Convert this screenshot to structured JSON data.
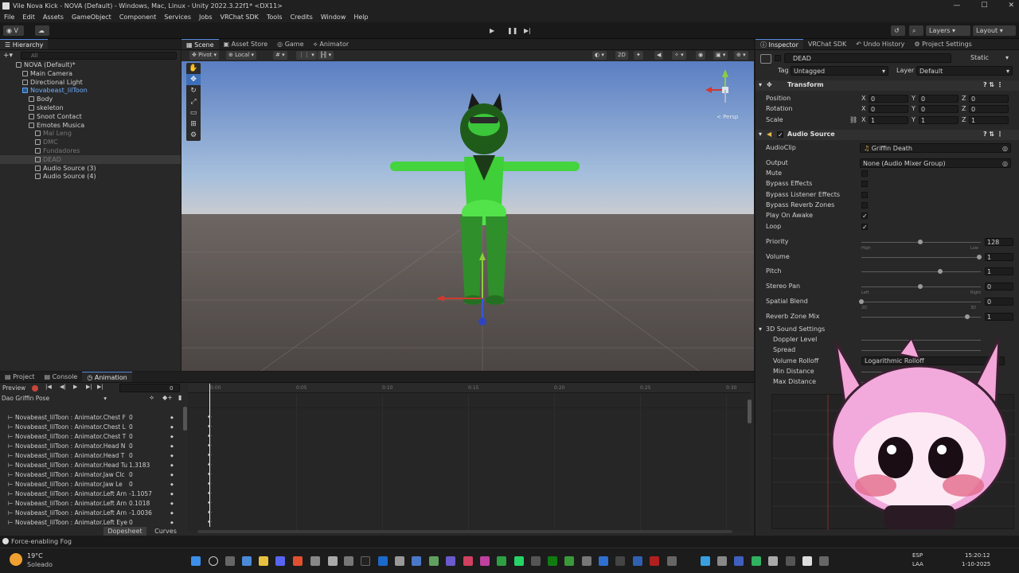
{
  "window": {
    "title": "Vile Nova Kick - NOVA (Default) - Windows, Mac, Linux - Unity 2022.3.22f1* <DX11>"
  },
  "menu": [
    "File",
    "Edit",
    "Assets",
    "GameObject",
    "Component",
    "Services",
    "Jobs",
    "VRChat SDK",
    "Tools",
    "Credits",
    "Window",
    "Help"
  ],
  "toolbar": {
    "account": "V",
    "layers_label": "Layers",
    "layout_label": "Layout"
  },
  "hierarchy": {
    "tab": "Hierarchy",
    "search_placeholder": "All",
    "items": [
      {
        "label": "NOVA (Default)*",
        "indent": 0,
        "dim": false
      },
      {
        "label": "Main Camera",
        "indent": 1,
        "dim": false
      },
      {
        "label": "Directional Light",
        "indent": 1,
        "dim": false
      },
      {
        "label": "Novabeast_lilToon",
        "indent": 1,
        "dim": false
      },
      {
        "label": "Body",
        "indent": 2,
        "dim": false
      },
      {
        "label": "skeleton",
        "indent": 2,
        "dim": false
      },
      {
        "label": "Snoot Contact",
        "indent": 2,
        "dim": false
      },
      {
        "label": "Emotes Musica",
        "indent": 2,
        "dim": false
      },
      {
        "label": "Mal Leng",
        "indent": 3,
        "dim": true
      },
      {
        "label": "DMC",
        "indent": 3,
        "dim": true
      },
      {
        "label": "Fundadores",
        "indent": 3,
        "dim": true
      },
      {
        "label": "DEAD",
        "indent": 3,
        "dim": true
      },
      {
        "label": "Audio Source (3)",
        "indent": 3,
        "dim": false
      },
      {
        "label": "Audio Source (4)",
        "indent": 3,
        "dim": false
      }
    ]
  },
  "scene": {
    "tabs": [
      "Scene",
      "Asset Store",
      "Game",
      "Animator"
    ],
    "pivot": "Pivot",
    "local": "Local",
    "mode_2d": "2D",
    "persp_label": "< Persp"
  },
  "inspector": {
    "tabs": [
      "Inspector",
      "VRChat SDK",
      "Undo History",
      "Project Settings"
    ],
    "object_name": "DEAD",
    "static_label": "Static",
    "tag_label": "Tag",
    "tag_value": "Untagged",
    "layer_label": "Layer",
    "layer_value": "Default",
    "transform": {
      "title": "Transform",
      "rows": [
        {
          "label": "Position",
          "x": "0",
          "y": "0",
          "z": "0"
        },
        {
          "label": "Rotation",
          "x": "0",
          "y": "0",
          "z": "0"
        },
        {
          "label": "Scale",
          "x": "1",
          "y": "1",
          "z": "1"
        }
      ]
    },
    "audio": {
      "title": "Audio Source",
      "clip_label": "AudioClip",
      "clip_value": "Griffin Death",
      "output_label": "Output",
      "output_value": "None (Audio Mixer Group)",
      "toggles": [
        {
          "label": "Mute",
          "checked": false
        },
        {
          "label": "Bypass Effects",
          "checked": false
        },
        {
          "label": "Bypass Listener Effects",
          "checked": false
        },
        {
          "label": "Bypass Reverb Zones",
          "checked": false
        },
        {
          "label": "Play On Awake",
          "checked": true
        },
        {
          "label": "Loop",
          "checked": true
        }
      ],
      "sliders": [
        {
          "label": "Priority",
          "value": "128",
          "pos": 0.5,
          "left": "High",
          "right": "Low"
        },
        {
          "label": "Volume",
          "value": "1",
          "pos": 1.0,
          "left": "",
          "right": ""
        },
        {
          "label": "Pitch",
          "value": "1",
          "pos": 0.67,
          "left": "",
          "right": ""
        },
        {
          "label": "Stereo Pan",
          "value": "0",
          "pos": 0.5,
          "left": "Left",
          "right": "Right"
        },
        {
          "label": "Spatial Blend",
          "value": "0",
          "pos": 0.0,
          "left": "2D",
          "right": "3D"
        },
        {
          "label": "Reverb Zone Mix",
          "value": "1",
          "pos": 0.9,
          "left": "",
          "right": ""
        }
      ],
      "sound3d": {
        "title": "3D Sound Settings",
        "rows": [
          "Doppler Level",
          "Spread",
          "Volume Rolloff",
          "Min Distance",
          "Max Distance"
        ],
        "rolloff_value": "Logarithmic Rolloff"
      }
    }
  },
  "animation": {
    "tabs": [
      "Project",
      "Console",
      "Animation"
    ],
    "preview_label": "Preview",
    "frame_value": "0",
    "clip_name": "Dao Griffin Pose",
    "ruler": [
      "0:00",
      "0:05",
      "0:10",
      "0:15",
      "0:20",
      "0:25",
      "0:30"
    ],
    "properties": [
      {
        "label": "Novabeast_lilToon : Animator.Chest F",
        "value": "0"
      },
      {
        "label": "Novabeast_lilToon : Animator.Chest L",
        "value": "0"
      },
      {
        "label": "Novabeast_lilToon : Animator.Chest T",
        "value": "0"
      },
      {
        "label": "Novabeast_lilToon : Animator.Head N",
        "value": "0"
      },
      {
        "label": "Novabeast_lilToon : Animator.Head T",
        "value": "0"
      },
      {
        "label": "Novabeast_lilToon : Animator.Head Tu",
        "value": "1.3183"
      },
      {
        "label": "Novabeast_lilToon : Animator.Jaw Clc",
        "value": "0"
      },
      {
        "label": "Novabeast_lilToon : Animator.Jaw Le",
        "value": "0"
      },
      {
        "label": "Novabeast_lilToon : Animator.Left Arn",
        "value": "-1.1057"
      },
      {
        "label": "Novabeast_lilToon : Animator.Left Arn",
        "value": "0.1018"
      },
      {
        "label": "Novabeast_lilToon : Animator.Left Arn",
        "value": "-1.0036"
      },
      {
        "label": "Novabeast_lilToon : Animator.Left Eye",
        "value": "0"
      }
    ],
    "dopesheet_label": "Dopesheet",
    "curves_label": "Curves"
  },
  "status": {
    "message": "Force-enabling Fog"
  },
  "taskbar": {
    "temperature": "19°C",
    "weather": "Soleado",
    "lang": "ESP",
    "lang2": "LAA",
    "time": "15:20:12",
    "date": "1-10-2025"
  },
  "colors": {
    "accent": "#5a8de0",
    "selection": "#2c5d87",
    "record": "#c8463c",
    "avatar_green": "#3fd43a"
  }
}
